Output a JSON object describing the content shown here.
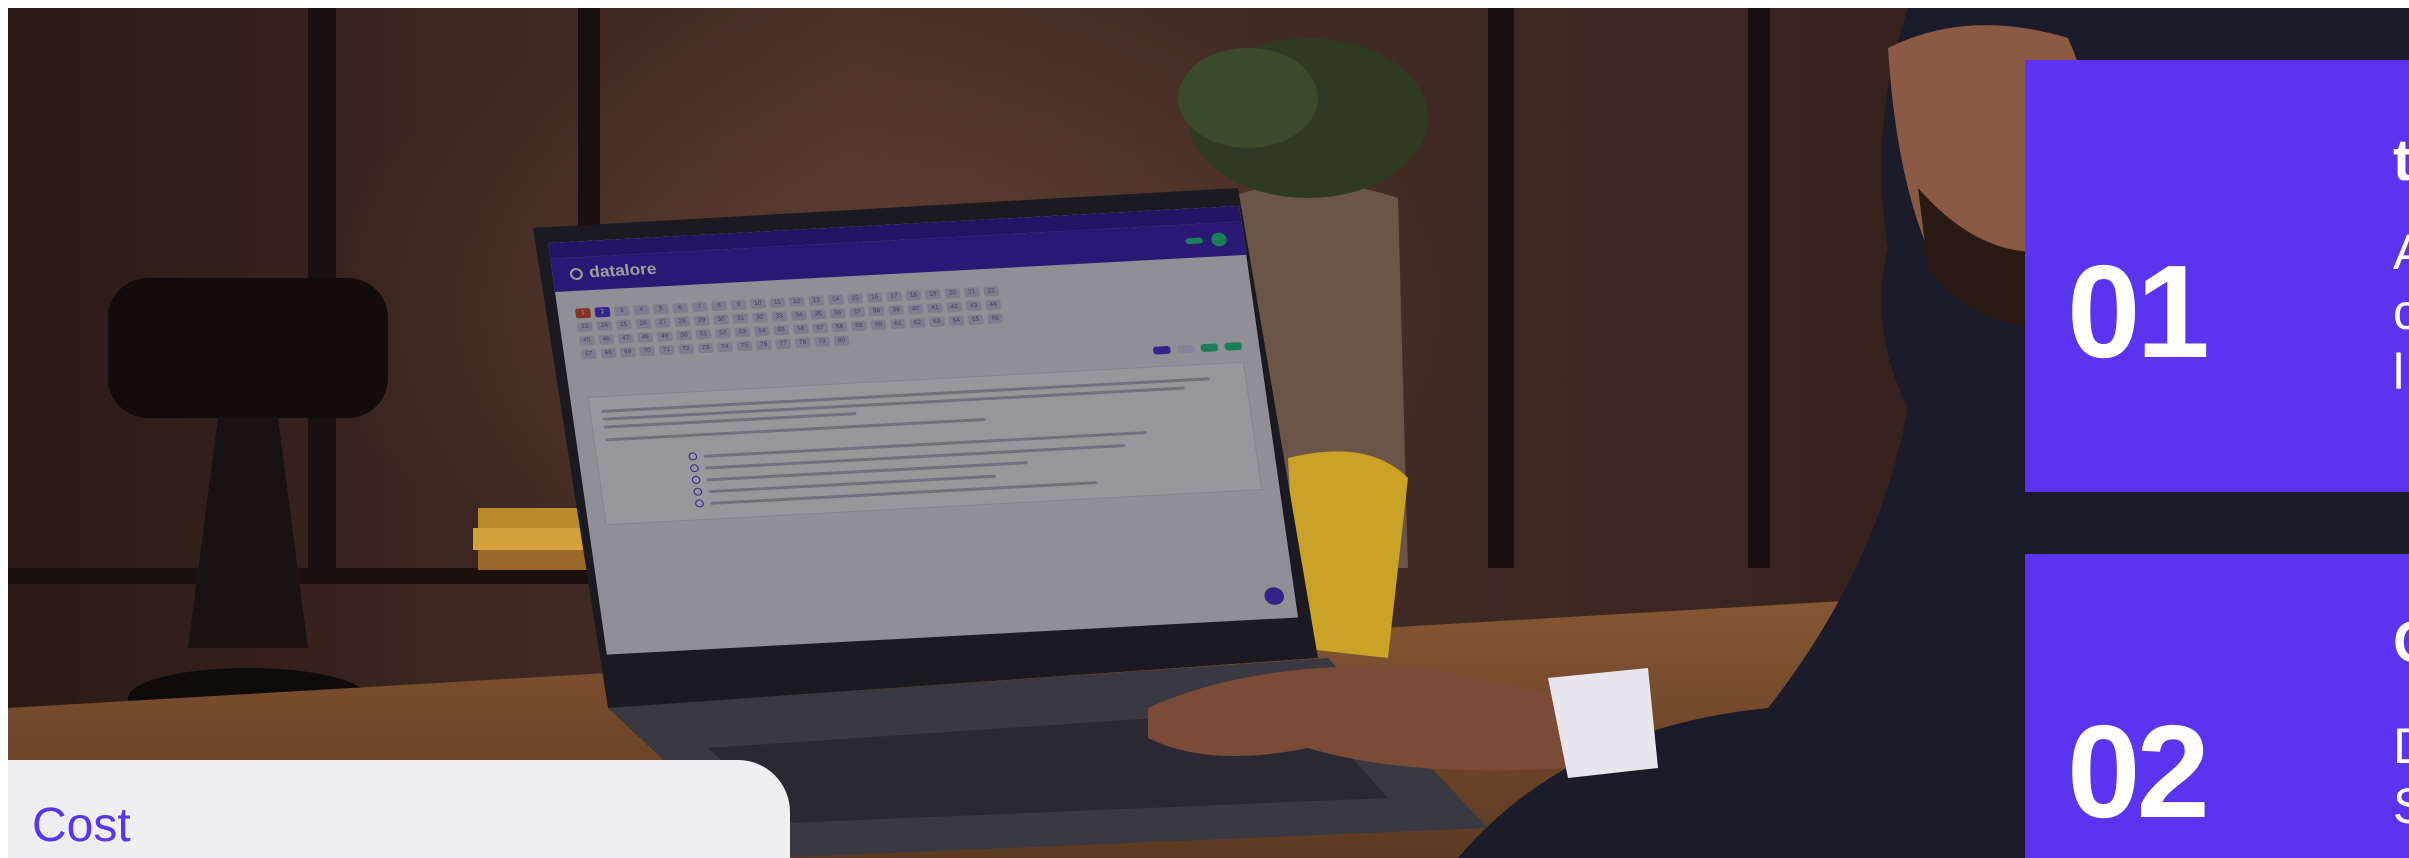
{
  "cards": [
    {
      "number": "01",
      "heading": "t",
      "description": "A\nc\nl"
    },
    {
      "number": "02",
      "heading": "C",
      "description": "D\nS"
    }
  ],
  "panel": {
    "title": "Cost"
  },
  "laptop_screen": {
    "top_strip": "",
    "brand": "datalore",
    "nav_links": "",
    "nav_right_text": "",
    "nav_button": "",
    "breadcrumb": "",
    "question_section_label": "",
    "question_numbers": [
      "1",
      "2",
      "3",
      "4",
      "5",
      "6",
      "7",
      "8",
      "9",
      "10",
      "11",
      "12",
      "13",
      "14",
      "15",
      "16",
      "17",
      "18",
      "19",
      "20",
      "21",
      "22",
      "23",
      "24",
      "25",
      "26",
      "27",
      "28",
      "29",
      "30",
      "31",
      "32",
      "33",
      "34",
      "35",
      "36",
      "37",
      "38",
      "39",
      "40",
      "41",
      "42",
      "43",
      "44",
      "45",
      "46",
      "47",
      "48",
      "49",
      "50",
      "51",
      "52",
      "53",
      "54",
      "55",
      "56",
      "57",
      "58",
      "59",
      "60",
      "61",
      "62",
      "63",
      "64",
      "65",
      "66",
      "67",
      "68",
      "69",
      "70",
      "71",
      "72",
      "73",
      "74",
      "75",
      "76",
      "77",
      "78",
      "79",
      "80"
    ],
    "question_label": "",
    "buttons": [
      "",
      "",
      "",
      ""
    ],
    "options_label": "",
    "options": [
      "",
      "",
      "",
      "",
      ""
    ]
  },
  "colors": {
    "brand": "#5b34f0",
    "accent_green": "#1fd08a",
    "panel_bg": "#efeff1"
  }
}
